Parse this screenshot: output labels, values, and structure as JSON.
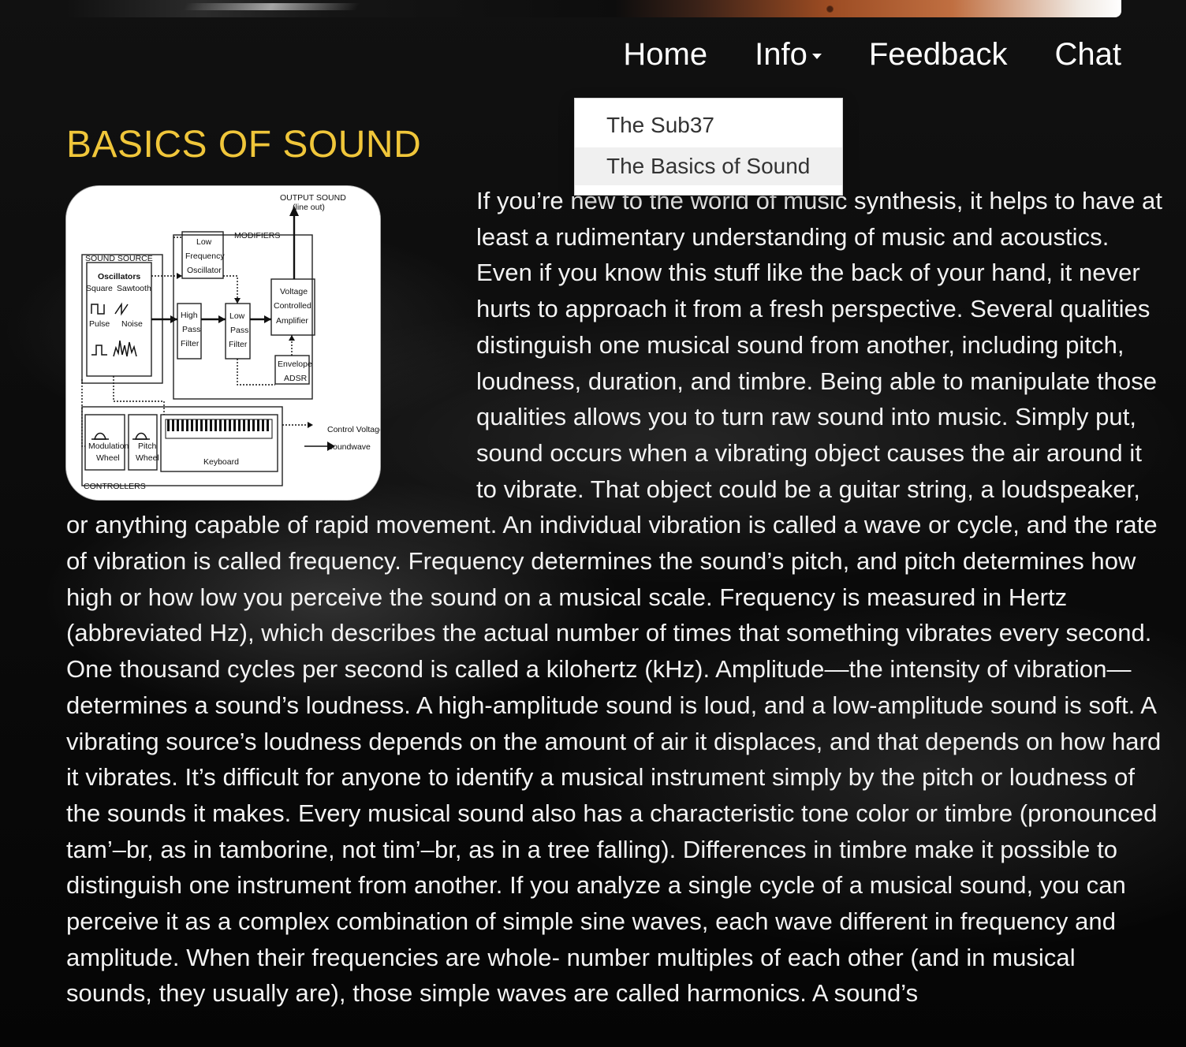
{
  "nav": {
    "home": "Home",
    "info": "Info",
    "feedback": "Feedback",
    "chat": "Chat"
  },
  "dropdown": {
    "items": [
      "The Sub37",
      "The Basics of Sound"
    ]
  },
  "page": {
    "title": "BASICS OF SOUND",
    "body": "If you’re new to the world of music synthesis, it helps to have at least a rudimentary understanding of music and acoustics. Even if you know this stuff like the back of your hand, it never hurts to approach it from a fresh perspective. Several qualities distinguish one musical sound from another, including pitch, loudness, duration, and timbre. Being able to manipulate those qualities allows you to turn raw sound into music. Simply put, sound occurs when a vibrating object causes the air around it to vibrate. That object could be a guitar string, a loudspeaker, or anything capable of rapid movement. An individual vibration is called a wave or cycle, and the rate of vibration is called frequency. Frequency determines the sound’s pitch, and pitch determines how high or how low you perceive the sound on a musical scale. Frequency is measured in Hertz (abbreviated Hz), which describes the actual number of times that something vibrates every second. One thousand cycles per second is called a kilohertz (kHz). Amplitude—the intensity of vibration—determines a sound’s loudness. A high-amplitude sound is loud, and a low-amplitude sound is soft. A vibrating source’s loudness depends on the amount of air it displaces, and that depends on how hard it vibrates. It’s difficult for anyone to identify a musical instrument simply by the pitch or loudness of the sounds it makes. Every musical sound also has a characteristic tone color or timbre (pronounced tam’–br, as in tamborine, not tim’–br, as in a tree falling). Differences in timbre make it possible to distinguish one instrument from another. If you analyze a single cycle of a musical sound, you can perceive it as a complex combination of simple sine waves, each wave different in frequency and amplitude. When their frequencies are whole- number multiples of each other (and in musical sounds, they usually are), those simple waves are called harmonics. A sound’s"
  },
  "diagram": {
    "output_sound": "OUTPUT SOUND",
    "line_out": "(line out)",
    "modifiers": "MODIFIERS",
    "sound_source": "SOUND SOURCE",
    "oscillators": "Oscillators",
    "square": "Square",
    "sawtooth": "Sawtooth",
    "pulse": "Pulse",
    "noise": "Noise",
    "lfo_line_1": "Low",
    "lfo_line_2": "Frequency",
    "lfo_line_3": "Oscillator",
    "hpf_line_1": "High",
    "hpf_line_2": "Pass",
    "hpf_line_3": "Filter",
    "lpf_line_1": "Low",
    "lpf_line_2": "Pass",
    "lpf_line_3": "Filter",
    "vca_line_1": "Voltage",
    "vca_line_2": "Controlled",
    "vca_line_3": "Amplifier",
    "env_line_1": "Envelope",
    "env_line_2": "ADSR",
    "mod_line_1": "Modulation",
    "mod_line_2": "Wheel",
    "pitch_line_1": "Pitch",
    "pitch_line_2": "Wheel",
    "keyboard": "Keyboard",
    "controllers": "CONTROLLERS",
    "control_voltage": "Control Voltage",
    "soundwave": "Soundwave"
  }
}
